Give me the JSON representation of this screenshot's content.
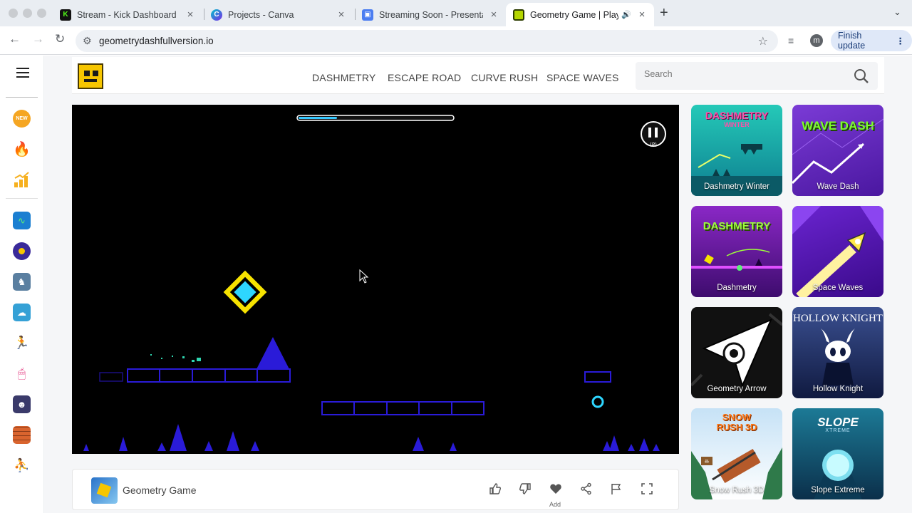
{
  "browser": {
    "tabs": [
      {
        "title": "Stream - Kick Dashboard",
        "favicon": "kick-icon",
        "color": "#53fc18"
      },
      {
        "title": "Projects - Canva",
        "favicon": "canva-icon",
        "color": "#7d2ae8"
      },
      {
        "title": "Streaming Soon - Presentatio",
        "favicon": "presentation-icon",
        "color": "#4b7df1"
      },
      {
        "title": "Geometry Game | Play Ge",
        "favicon": "geometry-game-icon",
        "color": "#b5d600",
        "active": true,
        "audio": true
      }
    ],
    "url": "geometrydashfullversion.io",
    "profile_initial": "m",
    "finish_update": "Finish update"
  },
  "sidebar": {
    "icons": [
      {
        "name": "new-icon",
        "label": "NEW",
        "color": "#f5a623"
      },
      {
        "name": "hot-icon",
        "color": "#e94235"
      },
      {
        "name": "trending-icon",
        "color": "#f6b01e"
      },
      {
        "name": "game-thumb-1",
        "color": "#1b7fd1"
      },
      {
        "name": "game-thumb-2",
        "color": "#3a2a9a"
      },
      {
        "name": "game-thumb-3",
        "color": "#5a7fa0"
      },
      {
        "name": "game-thumb-4",
        "color": "#35a1d6"
      },
      {
        "name": "game-thumb-5",
        "color": "#d8d8d8"
      },
      {
        "name": "game-thumb-6",
        "color": "#e64a8a"
      },
      {
        "name": "game-thumb-7",
        "color": "#3a3a6a"
      },
      {
        "name": "game-thumb-8",
        "color": "#d9642e"
      },
      {
        "name": "game-thumb-9",
        "color": "#d0d8de"
      }
    ]
  },
  "header": {
    "nav": [
      "DASHMETRY",
      "ESCAPE ROAD",
      "CURVE RUSH",
      "SPACE WAVES"
    ],
    "search_placeholder": "Search"
  },
  "game": {
    "progress": 0.25,
    "pause_hint": "(P)"
  },
  "bottom_bar": {
    "title": "Geometry Game",
    "add_label": "Add"
  },
  "cards": [
    {
      "label": "Dashmetry Winter",
      "art": "DASHMETRY",
      "art_sub": "WINTER",
      "bg": "#1ab8a8",
      "art_color": "#ff4fa8"
    },
    {
      "label": "Wave Dash",
      "art": "WAVE DASH",
      "bg": "#6a2bc0",
      "art_color": "#7dff2a"
    },
    {
      "label": "Dashmetry",
      "art": "DASHMETRY",
      "bg": "#7a1fb0",
      "art_color": "#9dff3a"
    },
    {
      "label": "Space Waves",
      "art": "",
      "bg": "#5e18b8",
      "art_color": "#ffe84a"
    },
    {
      "label": "Geometry Arrow",
      "art": "",
      "bg": "#111111",
      "art_color": "#ffffff"
    },
    {
      "label": "Hollow Knight",
      "art": "HOLLOW KNIGHT",
      "bg": "#26356b",
      "art_color": "#ffffff"
    },
    {
      "label": "Snow Rush 3D",
      "art": "SNOW RUSH 3D",
      "bg": "#cfe5f5",
      "art_color": "#ff7a1a"
    },
    {
      "label": "Slope Extreme",
      "art": "SLOPE",
      "art_sub": "XTREME",
      "bg": "#1c7a96",
      "art_color": "#ffffff"
    }
  ]
}
